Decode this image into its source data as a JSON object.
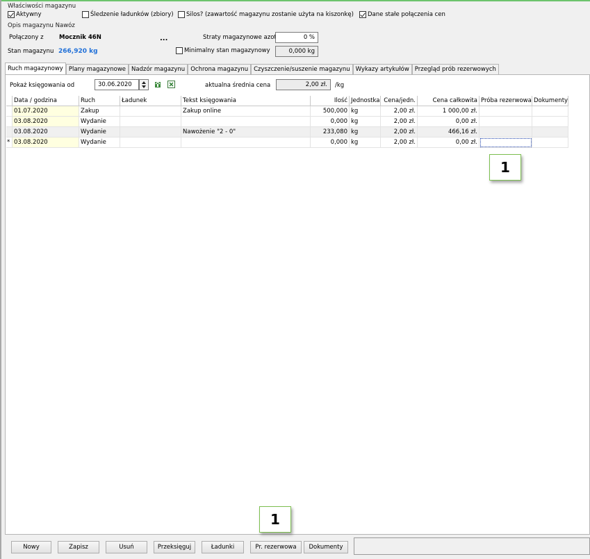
{
  "properties": {
    "group_title": "Właściwości magazynu",
    "active_label": "Aktywny",
    "batch_tracking_label": "Śledzenie ładunków (zbiory)",
    "silo_label": "Silos?  (zawartość magazynu zostanie użyta na kiszonkę)",
    "fixed_prices_label": "Dane stałe połączenia cen"
  },
  "description": {
    "group_title": "Opis magazynu Nawóz",
    "linked_label": "Połączony z",
    "linked_value": "Mocznik 46N",
    "ellipsis": "...",
    "nitrogen_loss_label": "Straty magazynowe azotu",
    "nitrogen_loss_value": "0 %",
    "stock_label": "Stan magazynu",
    "stock_value": "266,920 kg",
    "min_stock_label": "Minimalny stan magazynowy",
    "min_stock_value": "0,000 kg"
  },
  "tabs": [
    "Ruch magazynowy",
    "Plany magazynowe",
    "Nadzór magazynu",
    "Ochrona magazynu",
    "Czyszczenie/suszenie magazynu",
    "Wykazy artykułów",
    "Przegląd prób rezerwowych"
  ],
  "filter": {
    "show_from_label": "Pokaż księgowania od",
    "date_value": "30.06.2020",
    "avg_price_label": "aktualna średnia cena",
    "avg_price_value": "2,00 zł.",
    "unit_label": "/kg"
  },
  "table": {
    "columns": [
      "Data / godzina",
      "Ruch",
      "Ładunek",
      "Tekst księgowania",
      "Ilość",
      "Jednostka",
      "Cena/jedn.",
      "Cena całkowita",
      "Próba rezerwowa",
      "Dokumenty"
    ],
    "rows": [
      {
        "marker": "",
        "date": "01.07.2020",
        "movement": "Zakup",
        "batch": "",
        "text": "Zakup online",
        "qty": "500,000",
        "unit": "kg",
        "unit_price": "2,00 zł.",
        "total": "1 000,00 zł.",
        "sample": "",
        "docs": ""
      },
      {
        "marker": "",
        "date": "03.08.2020",
        "movement": "Wydanie",
        "batch": "",
        "text": "",
        "qty": "0,000",
        "unit": "kg",
        "unit_price": "2,00 zł.",
        "total": "0,00 zł.",
        "sample": "",
        "docs": ""
      },
      {
        "marker": "",
        "date": "03.08.2020",
        "movement": "Wydanie",
        "batch": "",
        "text": "Nawożenie \"2 - 0\"",
        "qty": "233,080",
        "unit": "kg",
        "unit_price": "2,00 zł.",
        "total": "466,16 zł.",
        "sample": "",
        "docs": ""
      },
      {
        "marker": "*",
        "date": "03.08.2020",
        "movement": "Wydanie",
        "batch": "",
        "text": "",
        "qty": "0,000",
        "unit": "kg",
        "unit_price": "2,00 zł.",
        "total": "0,00 zł.",
        "sample": "",
        "docs": ""
      }
    ]
  },
  "callouts": {
    "upper": "1",
    "lower": "1"
  },
  "buttons": {
    "new": "Nowy",
    "save": "Zapisz",
    "delete": "Usuń",
    "rebook": "Przeksięguj",
    "batches": "Ładunki",
    "reserve_sample": "Pr. rezerwowa",
    "documents": "Dokumenty"
  },
  "colors": {
    "stock_value": "#1f6fd8",
    "callout_border": "#7cbf4f",
    "date_cell": "#ffffe0"
  }
}
